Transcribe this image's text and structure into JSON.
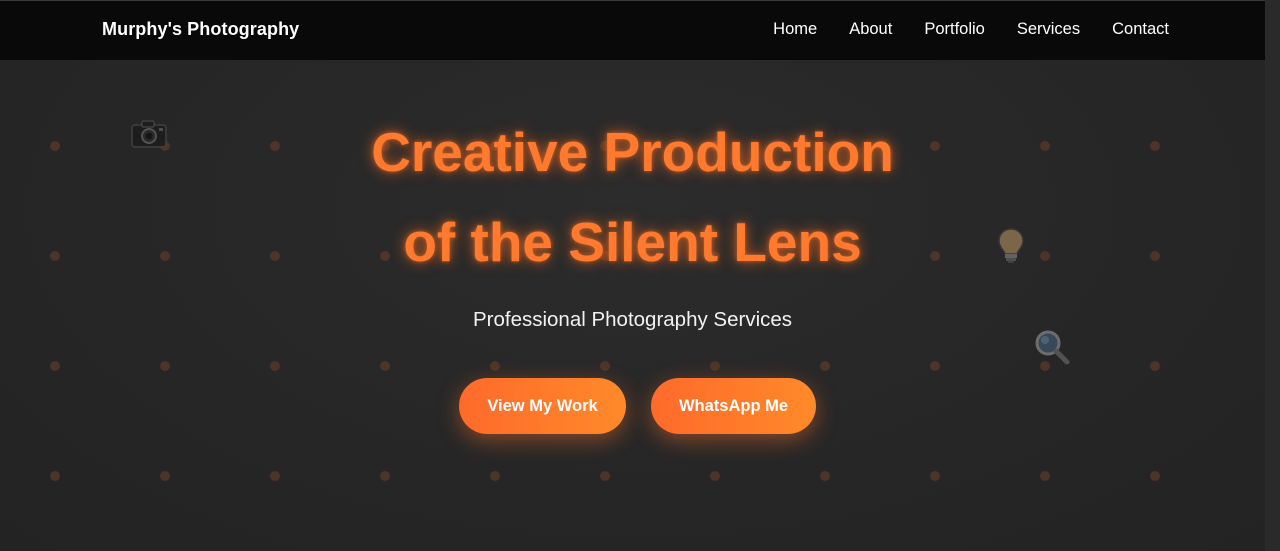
{
  "nav": {
    "brand": "Murphy's Photography",
    "links": [
      "Home",
      "About",
      "Portfolio",
      "Services",
      "Contact"
    ]
  },
  "hero": {
    "title_line1": "Creative Production",
    "title_line2": "of the Silent Lens",
    "subtitle": "Professional Photography Services",
    "button_work": "View My Work",
    "button_whatsapp": "WhatsApp Me"
  },
  "floating_icons": [
    "camera-icon",
    "lightbulb-icon",
    "magnifier-icon"
  ],
  "colors": {
    "accent": "#ff7a2e",
    "navbar_bg": "#090909",
    "hero_bg": "#262626",
    "dot": "#5a3a2a"
  }
}
